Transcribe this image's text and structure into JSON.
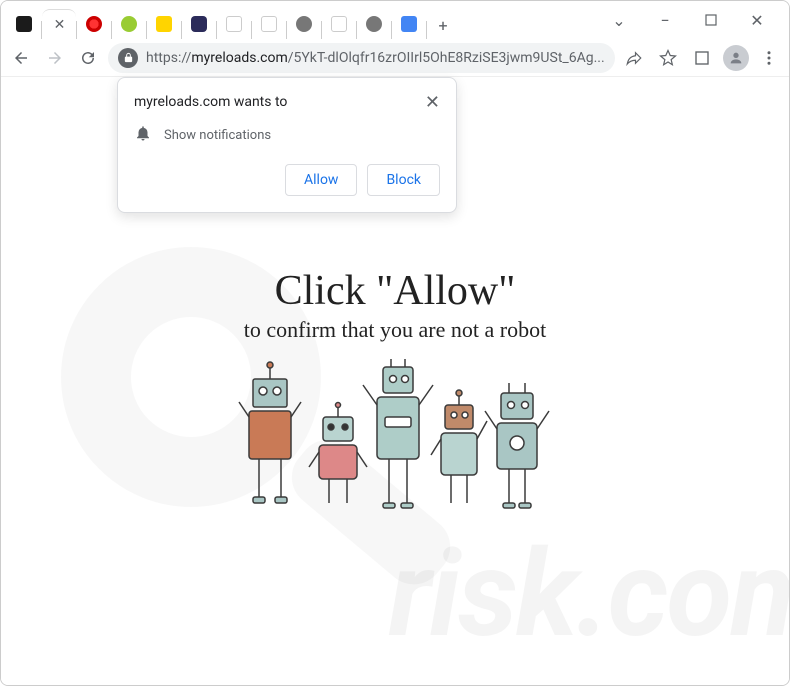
{
  "window": {
    "min": "−",
    "max": "▢",
    "close": "✕",
    "chevron": "⌄"
  },
  "tabs": {
    "newtab_label": "+"
  },
  "toolbar": {
    "url_proto": "https://",
    "url_host": "myreloads.com",
    "url_path": "/5YkT-dlOlqfr16zrOIIrl5OhE8RziSE3jwm9USt_6Ag..."
  },
  "permission": {
    "title": "myreloads.com wants to",
    "message": "Show notifications",
    "allow": "Allow",
    "block": "Block",
    "close": "✕"
  },
  "page": {
    "headline": "Click \"Allow\"",
    "subline": "to confirm that you are not a robot"
  },
  "watermark": {
    "text": "risk.com"
  }
}
